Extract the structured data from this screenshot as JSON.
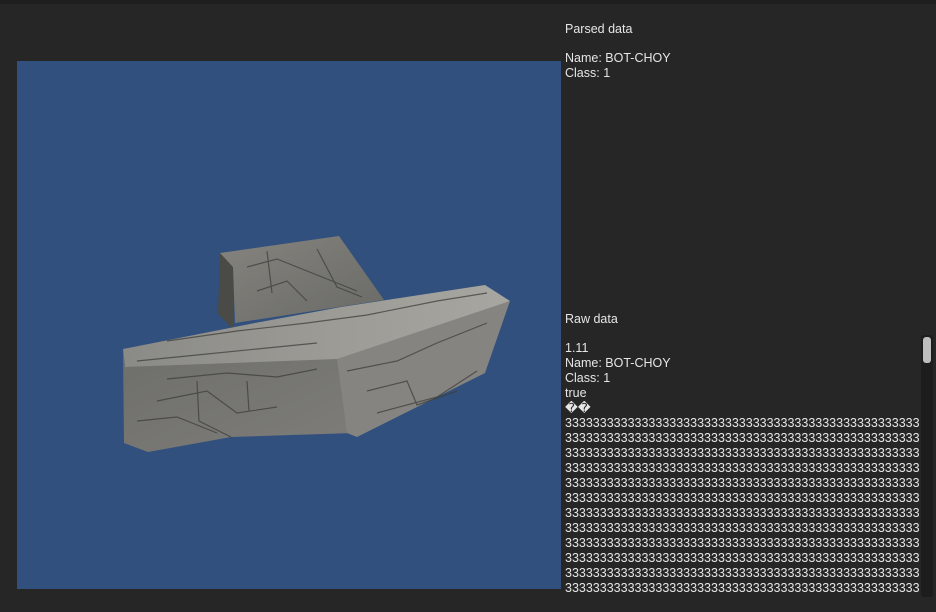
{
  "parsed": {
    "title": "Parsed data",
    "name": "Name: BOT-CHOY",
    "class": "Class: 1"
  },
  "raw": {
    "title": "Raw data",
    "lines": [
      "1.11",
      "Name: BOT-CHOY",
      "Class: 1",
      "true",
      "��"
    ],
    "digit_rows": [
      "333333333333333333333333333333333333333333333333333333",
      "333333333333333333333333333333333333333333333333333333",
      "333333333333333333333333333333333333333333333333333333",
      "333333333333333333333333333333333333333333333333333333",
      "333333333333333333333333333333333333333333333333333333",
      "333333333333333333333333333333333333333333333333333333",
      "333333333333333333333333333333333333333333333333333333",
      "333333333333333333333333333333333333333333333333333333",
      "333333333333333333333333333333333333333333333333333333",
      "333333333333333333333333333333333333333333333333333333",
      "333333333333333333333333333333333333333333333333333333",
      "333333333333333333333333333333333333333333333333333333"
    ]
  },
  "colors": {
    "viewport_background": "#32507d",
    "panel_background": "#262626",
    "text": "#e6e6e6"
  }
}
